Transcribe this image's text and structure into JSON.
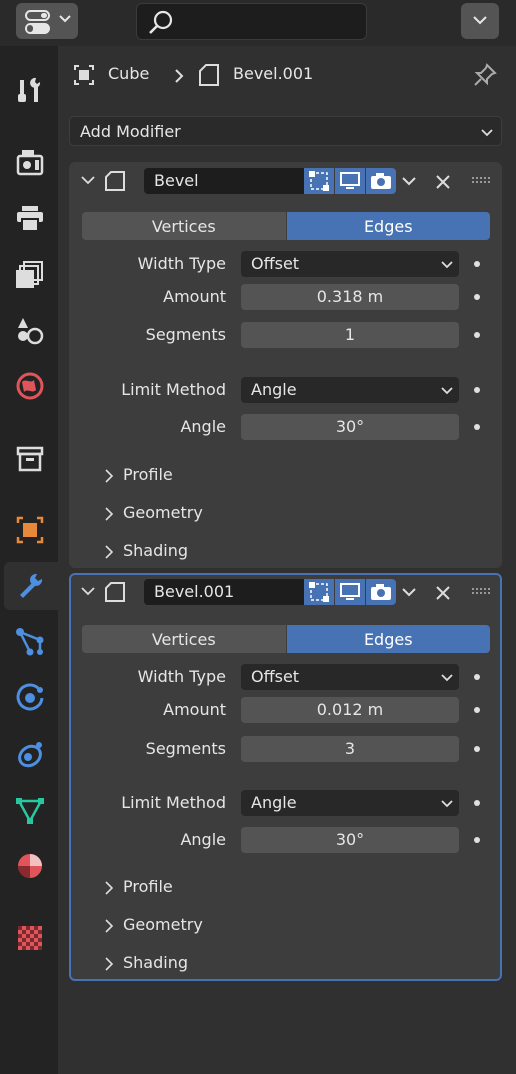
{
  "header": {
    "editor_icon": "properties-editor-icon",
    "search_placeholder": ""
  },
  "breadcrumb": {
    "object": "Cube",
    "modifier": "Bevel.001"
  },
  "add_modifier": {
    "label": "Add Modifier"
  },
  "tabs": [
    "tool-icon",
    "render-icon",
    "output-icon",
    "view-layer-icon",
    "scene-icon",
    "world-icon",
    "collection-icon",
    "object-icon",
    "modifier-icon",
    "particles-icon",
    "physics-icon",
    "constraints-icon",
    "data-icon",
    "material-icon",
    "texture-icon"
  ],
  "modifiers": [
    {
      "name": "Bevel",
      "affect": {
        "vertices": "Vertices",
        "edges": "Edges",
        "selected": "Edges"
      },
      "width_type_label": "Width Type",
      "width_type": "Offset",
      "amount_label": "Amount",
      "amount": "0.318 m",
      "segments_label": "Segments",
      "segments": "1",
      "limit_method_label": "Limit Method",
      "limit_method": "Angle",
      "angle_label": "Angle",
      "angle": "30°",
      "subpanels": [
        "Profile",
        "Geometry",
        "Shading"
      ]
    },
    {
      "name": "Bevel.001",
      "affect": {
        "vertices": "Vertices",
        "edges": "Edges",
        "selected": "Edges"
      },
      "width_type_label": "Width Type",
      "width_type": "Offset",
      "amount_label": "Amount",
      "amount": "0.012 m",
      "segments_label": "Segments",
      "segments": "3",
      "limit_method_label": "Limit Method",
      "limit_method": "Angle",
      "angle_label": "Angle",
      "angle": "30°",
      "subpanels": [
        "Profile",
        "Geometry",
        "Shading"
      ]
    }
  ],
  "colors": {
    "accent": "#4772b3",
    "panel": "#3d3d3d",
    "background": "#303030"
  }
}
